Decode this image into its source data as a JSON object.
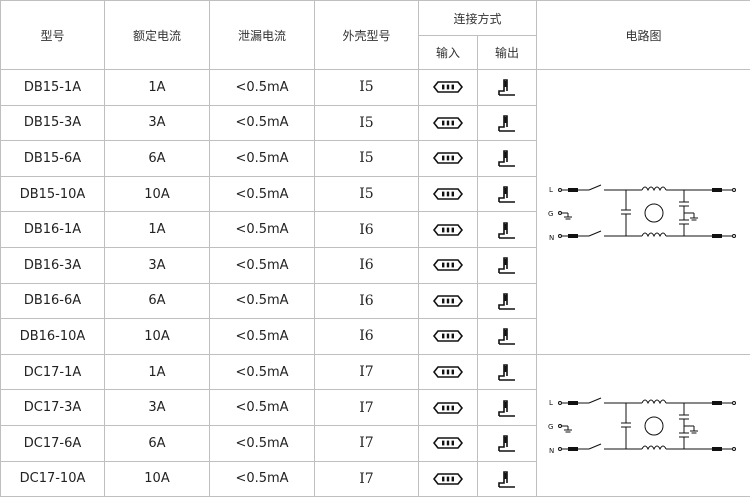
{
  "headers": {
    "model": "型号",
    "rated_current": "额定电流",
    "leakage_current": "泄漏电流",
    "housing_model": "外壳型号",
    "connection": "连接方式",
    "input": "输入",
    "output": "输出",
    "circuit": "电路图"
  },
  "rows": [
    {
      "model": "DB15-1A",
      "current": "1A",
      "leakage": "<0.5mA",
      "housing": "I5"
    },
    {
      "model": "DB15-3A",
      "current": "3A",
      "leakage": "<0.5mA",
      "housing": "I5"
    },
    {
      "model": "DB15-6A",
      "current": "6A",
      "leakage": "<0.5mA",
      "housing": "I5"
    },
    {
      "model": "DB15-10A",
      "current": "10A",
      "leakage": "<0.5mA",
      "housing": "I5"
    },
    {
      "model": "DB16-1A",
      "current": "1A",
      "leakage": "<0.5mA",
      "housing": "I6"
    },
    {
      "model": "DB16-3A",
      "current": "3A",
      "leakage": "<0.5mA",
      "housing": "I6"
    },
    {
      "model": "DB16-6A",
      "current": "6A",
      "leakage": "<0.5mA",
      "housing": "I6"
    },
    {
      "model": "DB16-10A",
      "current": "10A",
      "leakage": "<0.5mA",
      "housing": "I6"
    },
    {
      "model": "DC17-1A",
      "current": "1A",
      "leakage": "<0.5mA",
      "housing": "I7"
    },
    {
      "model": "DC17-3A",
      "current": "3A",
      "leakage": "<0.5mA",
      "housing": "I7"
    },
    {
      "model": "DC17-6A",
      "current": "6A",
      "leakage": "<0.5mA",
      "housing": "I7"
    },
    {
      "model": "DC17-10A",
      "current": "10A",
      "leakage": "<0.5mA",
      "housing": "I7"
    }
  ],
  "circuit_labels": {
    "l": "L",
    "g": "G",
    "n": "N"
  },
  "icons": {
    "input": "iec-inlet-icon",
    "output": "solder-terminal-icon"
  }
}
